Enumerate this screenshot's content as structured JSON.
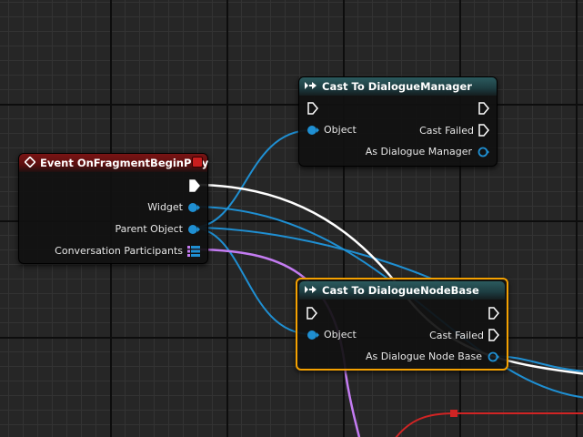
{
  "colors": {
    "grid_bg": "#262626",
    "exec_wire": "#ffffff",
    "object_wire": "#1f8fd2",
    "array_wire": "#c47cf2",
    "red_wire": "#d12424",
    "selection": "#f5a100",
    "cast_header": "#2b5a5e",
    "event_header": "#7a1414"
  },
  "nodes": {
    "cast_manager": {
      "title": "Cast To DialogueManager",
      "icon": "cast-icon",
      "pins": {
        "object": "Object",
        "cast_failed": "Cast Failed",
        "as_result": "As Dialogue Manager"
      }
    },
    "event": {
      "title": "Event OnFragmentBeginPlay",
      "icon": "event-diamond-icon",
      "pins": {
        "widget": "Widget",
        "parent_object": "Parent Object",
        "participants": "Conversation Participants"
      }
    },
    "cast_nodebase": {
      "title": "Cast To DialogueNodeBase",
      "icon": "cast-icon",
      "selected": true,
      "pins": {
        "object": "Object",
        "cast_failed": "Cast Failed",
        "as_result": "As Dialogue Node Base"
      }
    }
  }
}
